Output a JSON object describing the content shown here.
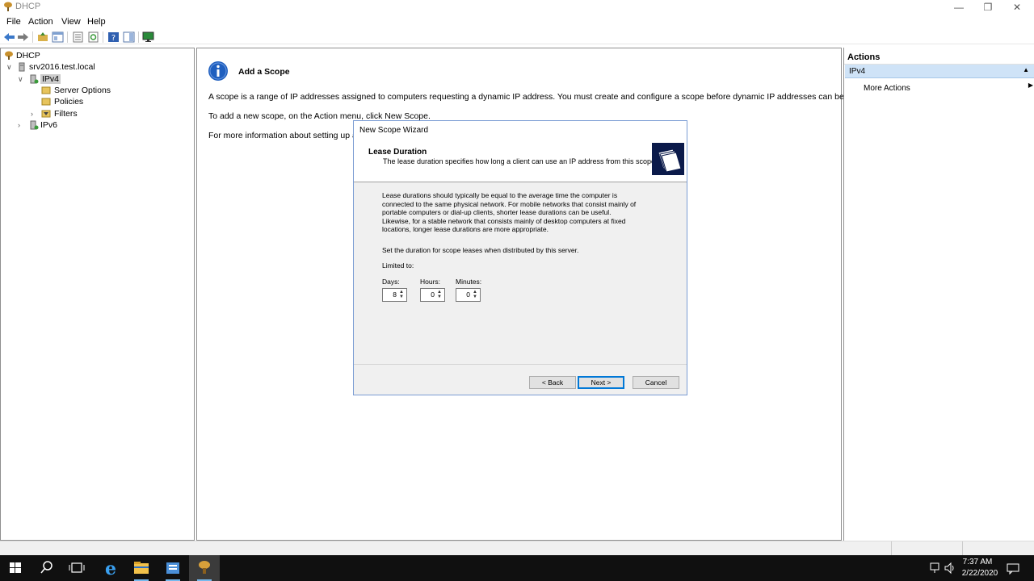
{
  "window": {
    "title": "DHCP"
  },
  "menu": [
    "File",
    "Action",
    "View",
    "Help"
  ],
  "tree": {
    "root": "DHCP",
    "server": "srv2016.test.local",
    "ipv4": "IPv4",
    "server_options": "Server Options",
    "policies": "Policies",
    "filters": "Filters",
    "ipv6": "IPv6"
  },
  "center": {
    "heading": "Add a Scope",
    "line1": "A scope is a range of IP addresses assigned to computers requesting a dynamic IP address. You must create and configure a scope before dynamic IP addresses can be assigned.",
    "line2": "To add a new scope, on the Action menu, click New Scope.",
    "line3": "For more information about setting up a D"
  },
  "actions": {
    "title": "Actions",
    "section": "IPv4",
    "more": "More Actions"
  },
  "wizard": {
    "title": "New Scope Wizard",
    "header_title": "Lease Duration",
    "header_desc": "The lease duration specifies how long a client can use an IP address from this scope.",
    "para_lines": [
      "Lease durations should typically be equal to the average time the computer is",
      "connected to the same physical network. For mobile networks that consist mainly of",
      "portable computers or dial-up clients, shorter lease durations can be useful.",
      "Likewise, for a stable network that consists mainly of desktop computers at fixed",
      "locations, longer lease durations are more appropriate."
    ],
    "set_duration": "Set the duration for scope leases when distributed by this server.",
    "limited_to": "Limited to:",
    "days_label": "Days:",
    "hours_label": "Hours:",
    "minutes_label": "Minutes:",
    "days_value": "8",
    "hours_value": "0",
    "minutes_value": "0",
    "back": "< Back",
    "next": "Next >",
    "cancel": "Cancel"
  },
  "tray": {
    "time": "7:37 AM",
    "date": "2/22/2020"
  },
  "colors": {
    "accent": "#0078d7",
    "taskbar": "#101010",
    "dialog_bg": "#f0f0f0"
  }
}
